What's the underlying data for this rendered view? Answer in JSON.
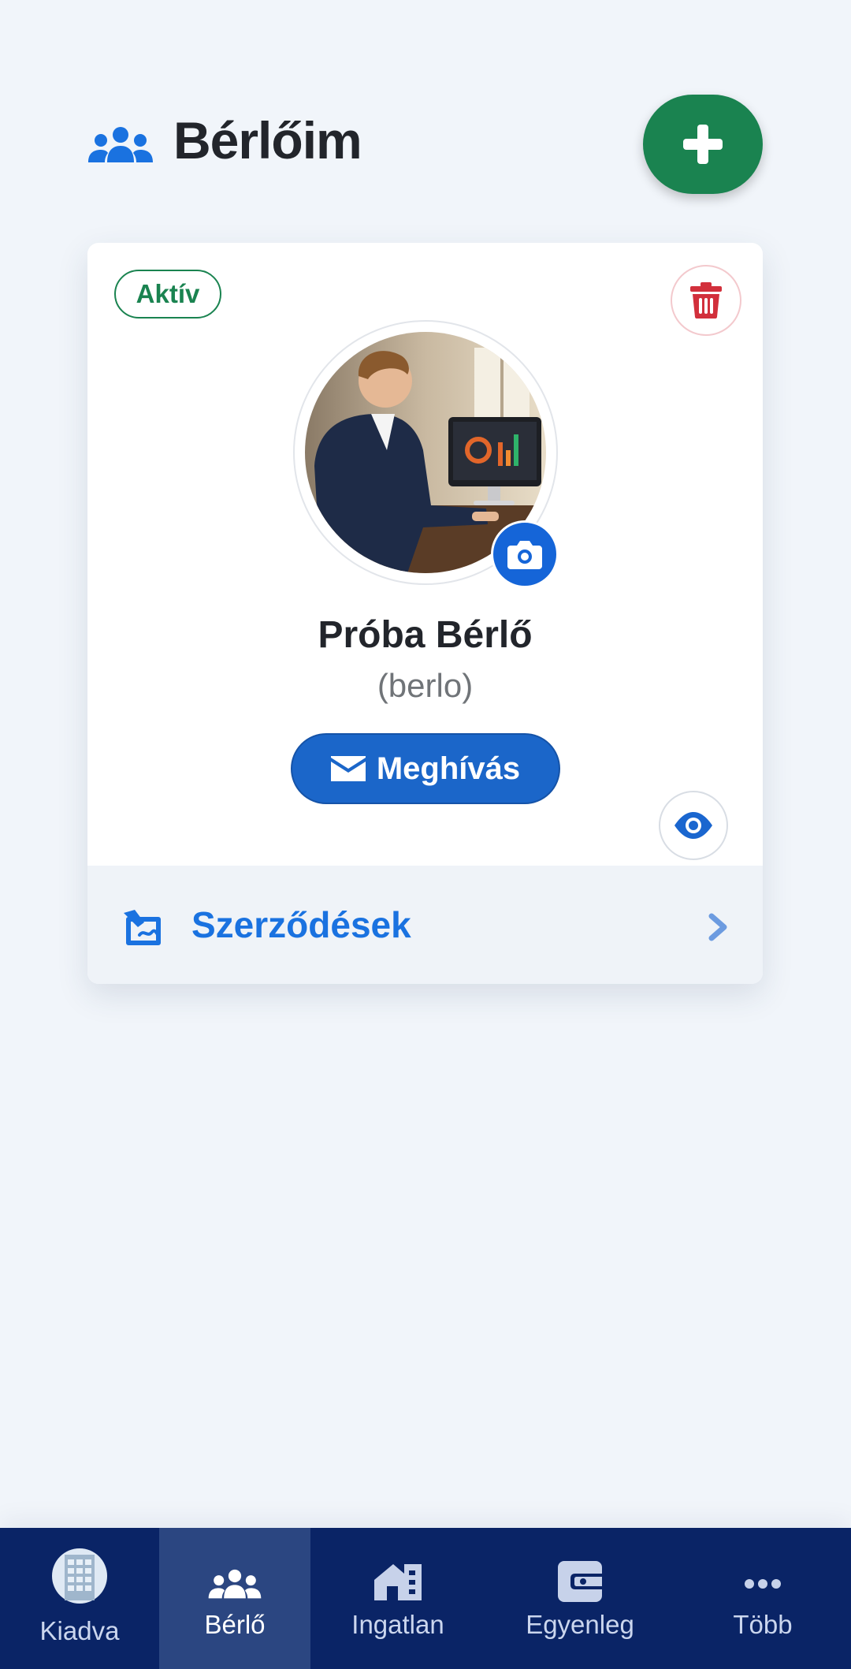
{
  "header": {
    "title": "Bérlőim",
    "icon": "users-icon",
    "add_icon": "plus-icon"
  },
  "tenant_card": {
    "status": "Aktív",
    "name": "Próba Bérlő",
    "username": "(berlo)",
    "invite_label": "Meghívás",
    "contracts_label": "Szerződések",
    "icons": {
      "delete": "trash-icon",
      "camera": "camera-icon",
      "invite": "envelope-icon",
      "view": "eye-icon",
      "contracts": "signature-icon",
      "chevron": "chevron-right-icon"
    }
  },
  "bottom_nav": {
    "items": [
      {
        "label": "Kiadva",
        "icon": "building-icon",
        "active": false
      },
      {
        "label": "Bérlő",
        "icon": "users-icon",
        "active": true
      },
      {
        "label": "Ingatlan",
        "icon": "house-icon",
        "active": false
      },
      {
        "label": "Egyenleg",
        "icon": "wallet-icon",
        "active": false
      },
      {
        "label": "Több",
        "icon": "more-icon",
        "active": false
      }
    ]
  },
  "colors": {
    "background": "#f1f5fa",
    "primary": "#1b66c9",
    "success": "#1a8350",
    "danger": "#d2303c",
    "nav_background": "#0a2466",
    "nav_active": "#2b4681"
  }
}
